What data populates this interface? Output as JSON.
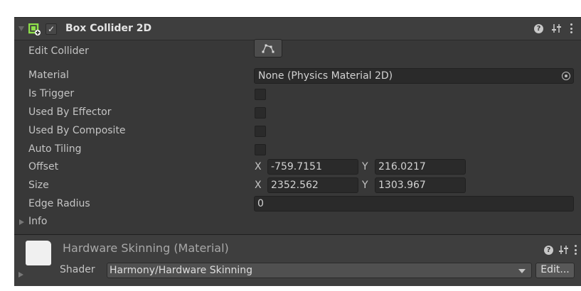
{
  "component": {
    "title": "Box Collider 2D",
    "enabled_mark": "✓",
    "icon": "box-collider-2d-icon",
    "accent": "#8ee04a"
  },
  "header_icons": [
    "help-icon",
    "presets-icon",
    "context-menu-icon"
  ],
  "properties": {
    "edit_collider": {
      "label": "Edit Collider",
      "icon": "edit-collider-icon"
    },
    "material": {
      "label": "Material",
      "value": "None (Physics Material 2D)"
    },
    "is_trigger": {
      "label": "Is Trigger",
      "checked": false
    },
    "used_by_effector": {
      "label": "Used By Effector",
      "checked": false
    },
    "used_by_composite": {
      "label": "Used By Composite",
      "checked": false
    },
    "auto_tiling": {
      "label": "Auto Tiling",
      "checked": false
    },
    "offset": {
      "label": "Offset",
      "x_label": "X",
      "x": "-759.7151",
      "y_label": "Y",
      "y": "216.0217"
    },
    "size": {
      "label": "Size",
      "x_label": "X",
      "x": "2352.562",
      "y_label": "Y",
      "y": "1303.967"
    },
    "edge_radius": {
      "label": "Edge Radius",
      "value": "0"
    },
    "info": {
      "label": "Info"
    }
  },
  "material_section": {
    "title": "Hardware Skinning (Material)",
    "shader_label": "Shader",
    "shader_value": "Harmony/Hardware Skinning",
    "edit_label": "Edit..."
  }
}
